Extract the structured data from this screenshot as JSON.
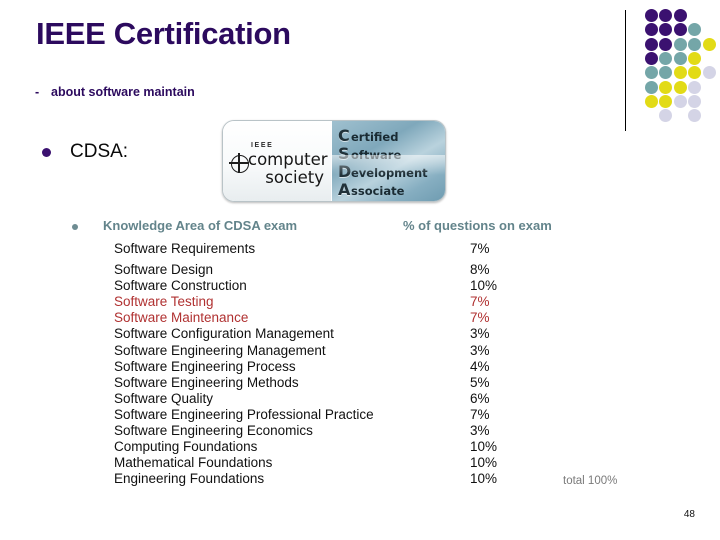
{
  "slide": {
    "title": "IEEE Certification",
    "subtitle_dash": "-",
    "subtitle": "about software maintain",
    "cdsa_label": "CDSA:",
    "page_number": "48",
    "total_label": "total  100%"
  },
  "logo": {
    "name": "csda-logo",
    "ieee_tag": "IEEE",
    "computer": "computer",
    "society": "society",
    "csda": [
      {
        "cap": "C",
        "rest": "ertified"
      },
      {
        "cap": "S",
        "rest": "oftware"
      },
      {
        "cap": "D",
        "rest": "evelopment"
      },
      {
        "cap": "A",
        "rest": "ssociate"
      }
    ]
  },
  "table": {
    "header_left": "Knowledge Area of CDSA exam",
    "header_right": "% of questions on exam",
    "rows": [
      {
        "name": "Software Requirements",
        "pct": "7%",
        "highlight": false
      },
      {
        "name": "Software Design",
        "pct": "8%",
        "highlight": false
      },
      {
        "name": "Software Construction",
        "pct": "10%",
        "highlight": false
      },
      {
        "name": "Software Testing",
        "pct": "7%",
        "highlight": true
      },
      {
        "name": "Software Maintenance",
        "pct": "7%",
        "highlight": true
      },
      {
        "name": "Software Configuration Management",
        "pct": "3%",
        "highlight": false
      },
      {
        "name": "Software Engineering Management",
        "pct": "3%",
        "highlight": false
      },
      {
        "name": "Software Engineering Process",
        "pct": "4%",
        "highlight": false
      },
      {
        "name": "Software Engineering Methods",
        "pct": "5%",
        "highlight": false
      },
      {
        "name": "Software Quality",
        "pct": "6%",
        "highlight": false
      },
      {
        "name": "Software Engineering Professional Practice",
        "pct": "7%",
        "highlight": false
      },
      {
        "name": "Software Engineering Economics",
        "pct": "3%",
        "highlight": false
      },
      {
        "name": "Computing Foundations",
        "pct": "10%",
        "highlight": false
      },
      {
        "name": "Mathematical Foundations",
        "pct": "10%",
        "highlight": false
      },
      {
        "name": "Engineering Foundations",
        "pct": "10%",
        "highlight": false
      }
    ]
  },
  "colors": {
    "title_purple": "#2C0A5E",
    "header_teal": "#63848B",
    "highlight_red": "#B03131",
    "dot_purple": "#3B1170",
    "dot_teal": "#74A6A8",
    "dot_yellow": "#E2DB16",
    "dot_lavender": "#D4D4E6"
  },
  "decoration": {
    "dot_grid": [
      [
        "p",
        "p",
        "p",
        "",
        "",
        ""
      ],
      [
        "p",
        "p",
        "p",
        "t",
        "",
        ""
      ],
      [
        "p",
        "p",
        "t",
        "t",
        "y",
        ""
      ],
      [
        "p",
        "t",
        "t",
        "y",
        "",
        ""
      ],
      [
        "t",
        "t",
        "y",
        "y",
        "l",
        ""
      ],
      [
        "t",
        "y",
        "y",
        "l",
        "",
        ""
      ],
      [
        "y",
        "y",
        "l",
        "l",
        "",
        ""
      ],
      [
        "",
        "l",
        "",
        "l",
        "",
        ""
      ]
    ]
  }
}
